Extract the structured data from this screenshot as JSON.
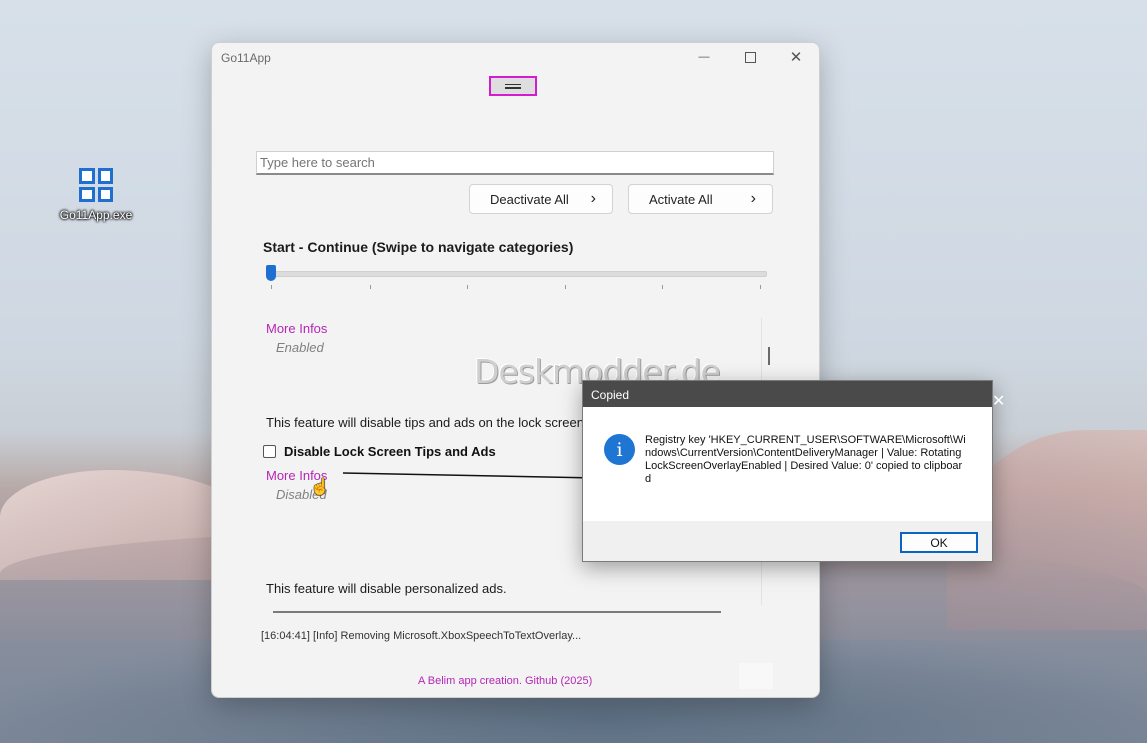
{
  "desktop": {
    "icon_label": "Go11App.exe"
  },
  "window": {
    "title": "Go11App",
    "minimize_glyph": "—",
    "close_glyph": "✕"
  },
  "search": {
    "placeholder": "Type here to search"
  },
  "buttons": {
    "deactivate": "Deactivate All",
    "activate": "Activate All",
    "chevron": "›"
  },
  "category": {
    "title": "Start - Continue (Swipe to navigate categories)"
  },
  "features": [
    {
      "more_infos": "More Infos",
      "state": "Enabled"
    },
    {
      "description": "This feature will disable tips and ads on the lock screen.",
      "label": "Disable Lock Screen Tips and Ads",
      "more_infos": "More Infos",
      "state": "Disabled"
    },
    {
      "description": "This feature will disable personalized ads."
    }
  ],
  "log": {
    "text": "[16:04:41] [Info] Removing Microsoft.XboxSpeechToTextOverlay..."
  },
  "footer": {
    "text": "A Belim app creation. Github (2025)"
  },
  "watermark": "Deskmodder.de",
  "dialog": {
    "title": "Copied",
    "close_glyph": "✕",
    "icon_glyph": "i",
    "message": "Registry key 'HKEY_CURRENT_USER\\SOFTWARE\\Microsoft\\Windows\\CurrentVersion\\ContentDeliveryManager | Value: RotatingLockScreenOverlayEnabled | Desired Value: 0' copied to clipboard",
    "ok_label": "OK"
  },
  "colors": {
    "accent": "#1e6fd0",
    "link": "#b626b6",
    "highlight": "#d31bd3"
  }
}
